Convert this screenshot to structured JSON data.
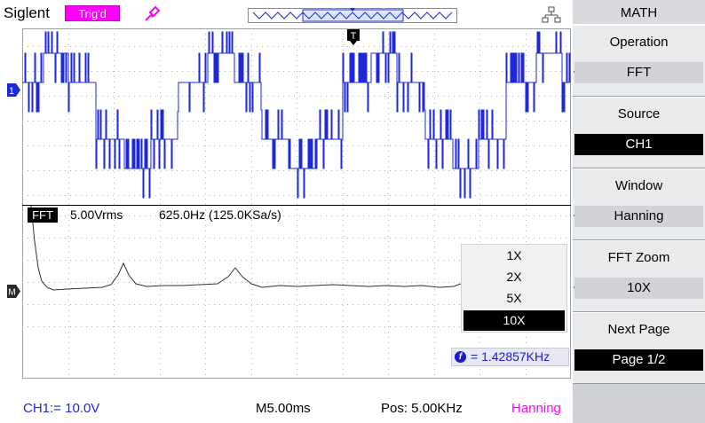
{
  "header": {
    "brand": "Siglent",
    "trigger_status": "Trig'd",
    "trigger_color": "#ff00ff"
  },
  "waveform": {
    "trigger_marker": "T",
    "channel_marker": "1",
    "math_marker": "M",
    "channel_color": "#1e28d8"
  },
  "fft": {
    "label": "FFT",
    "scale": "5.00Vrms",
    "span": "625.0Hz (125.0KSa/s)",
    "cursor_freq": "= 1.42857KHz",
    "cursor_icon": "f"
  },
  "zoom_popup": {
    "options": [
      "1X",
      "2X",
      "5X",
      "10X"
    ],
    "selected": "10X"
  },
  "status": {
    "channel": "CH1:= 10.0V",
    "timebase": "M5.00ms",
    "position": "Pos: 5.00KHz",
    "window": "Hanning",
    "channel_color": "#1e28d8",
    "window_color": "#ff00ff"
  },
  "menu": {
    "title": "MATH",
    "items": [
      {
        "label": "Operation",
        "value": "FFT"
      },
      {
        "label": "Source",
        "value": "CH1"
      },
      {
        "label": "Window",
        "value": "Hanning"
      },
      {
        "label": "FFT Zoom",
        "value": "10X"
      },
      {
        "label": "Next Page",
        "value": "Page 1/2"
      }
    ]
  }
}
